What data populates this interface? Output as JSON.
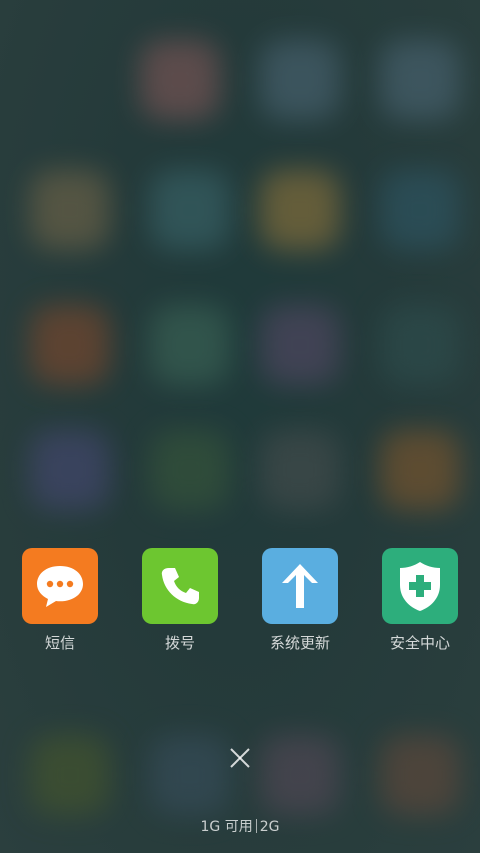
{
  "recent_apps": [
    {
      "label": "短信",
      "icon": "message-bubble-icon",
      "color": "#F47B20"
    },
    {
      "label": "拨号",
      "icon": "phone-icon",
      "color": "#6DC630"
    },
    {
      "label": "系统更新",
      "icon": "arrow-up-icon",
      "color": "#5AAEE0"
    },
    {
      "label": "安全中心",
      "icon": "shield-plus-icon",
      "color": "#2DAE7C"
    }
  ],
  "memory": {
    "available": "1G 可用",
    "total": "2G"
  },
  "close_icon": "close-icon",
  "colors": {
    "background": "#243a3a",
    "label_text": "#ffffff"
  }
}
